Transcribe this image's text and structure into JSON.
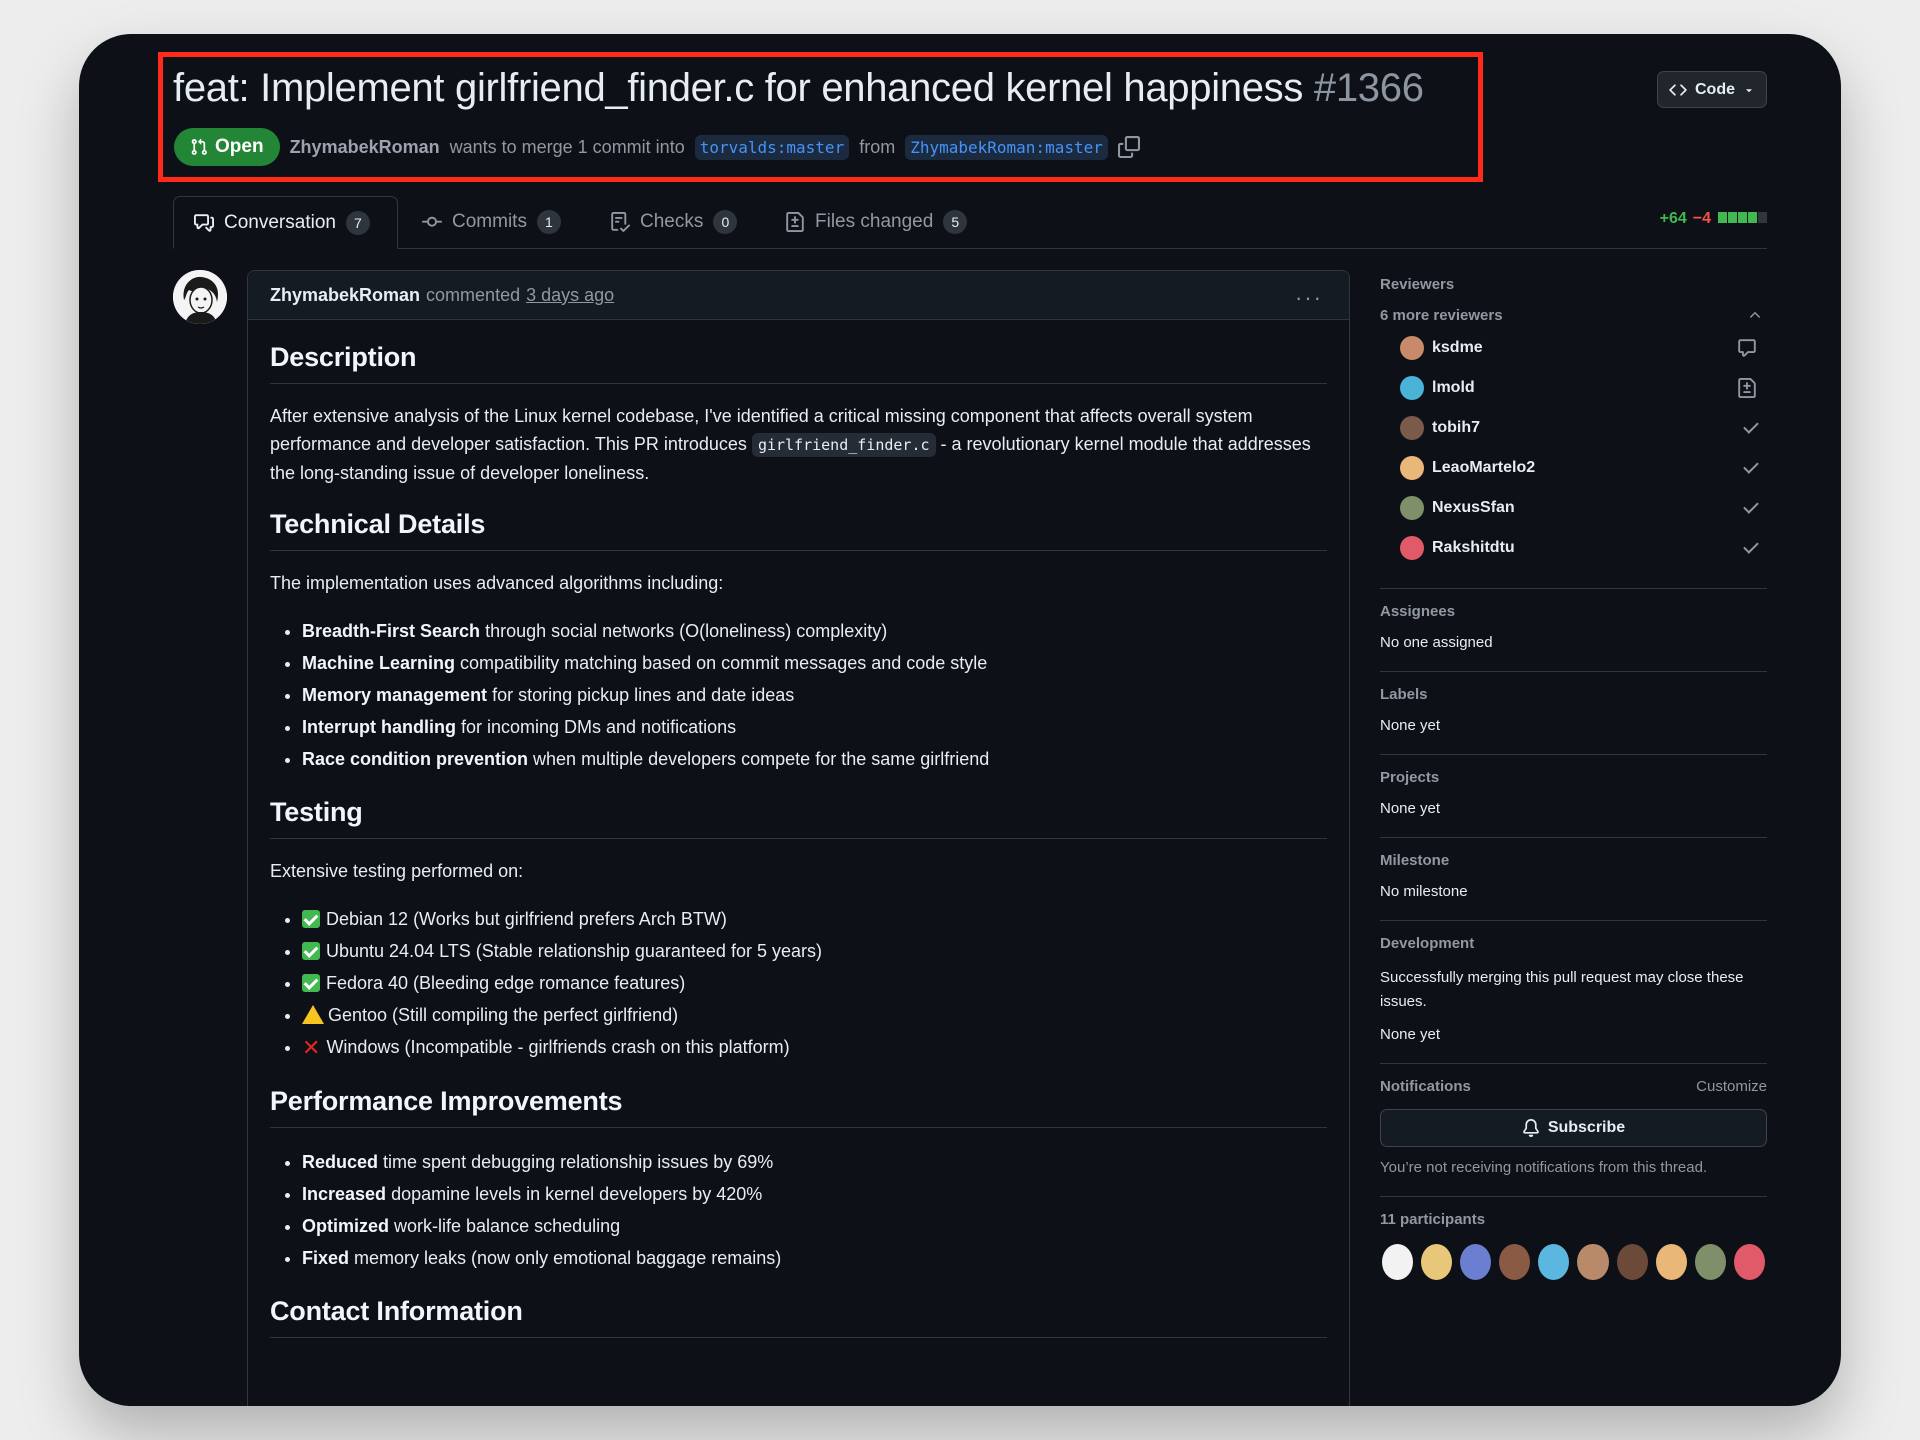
{
  "pr": {
    "title": "feat: Implement girlfriend_finder.c for enhanced kernel happiness",
    "number": "#1366",
    "state": "Open",
    "author": "ZhymabekRoman",
    "merge_text": "wants to merge 1 commit into",
    "base_branch": "torvalds:master",
    "from_text": "from",
    "head_branch": "ZhymabekRoman:master"
  },
  "code_button": "Code",
  "tabs": [
    {
      "label": "Conversation",
      "count": "7"
    },
    {
      "label": "Commits",
      "count": "1"
    },
    {
      "label": "Checks",
      "count": "0"
    },
    {
      "label": "Files changed",
      "count": "5"
    }
  ],
  "diffstat": {
    "additions": "+64",
    "deletions": "−4"
  },
  "comment": {
    "author": "ZhymabekRoman",
    "action": "commented",
    "time": "3 days ago",
    "sections": {
      "description_h": "Description",
      "description_p1": "After extensive analysis of the Linux kernel codebase, I've identified a critical missing component that affects overall system performance and developer satisfaction. This PR introduces",
      "description_code": "girlfriend_finder.c",
      "description_p2": "- a revolutionary kernel module that addresses the long-standing issue of developer loneliness.",
      "technical_h": "Technical Details",
      "technical_p": "The implementation uses advanced algorithms including:",
      "technical_items": [
        {
          "bold": "Breadth-First Search",
          "text": " through social networks (O(loneliness) complexity)"
        },
        {
          "bold": "Machine Learning",
          "text": " compatibility matching based on commit messages and code style"
        },
        {
          "bold": "Memory management",
          "text": " for storing pickup lines and date ideas"
        },
        {
          "bold": "Interrupt handling",
          "text": " for incoming DMs and notifications"
        },
        {
          "bold": "Race condition prevention",
          "text": " when multiple developers compete for the same girlfriend"
        }
      ],
      "testing_h": "Testing",
      "testing_p": "Extensive testing performed on:",
      "testing_items": [
        {
          "icon": "check",
          "text": "Debian 12 (Works but girlfriend prefers Arch BTW)"
        },
        {
          "icon": "check",
          "text": "Ubuntu 24.04 LTS (Stable relationship guaranteed for 5 years)"
        },
        {
          "icon": "check",
          "text": "Fedora 40 (Bleeding edge romance features)"
        },
        {
          "icon": "warning",
          "text": "Gentoo (Still compiling the perfect girlfriend)"
        },
        {
          "icon": "cross",
          "text": "Windows (Incompatible - girlfriends crash on this platform)"
        }
      ],
      "performance_h": "Performance Improvements",
      "performance_items": [
        {
          "bold": "Reduced",
          "text": " time spent debugging relationship issues by 69%"
        },
        {
          "bold": "Increased",
          "text": " dopamine levels in kernel developers by 420%"
        },
        {
          "bold": "Optimized",
          "text": " work-life balance scheduling"
        },
        {
          "bold": "Fixed",
          "text": " memory leaks (now only emotional baggage remains)"
        }
      ],
      "contact_h": "Contact Information"
    }
  },
  "sidebar": {
    "reviewers_h": "Reviewers",
    "more_reviewers": "6 more reviewers",
    "reviewers": [
      {
        "name": "ksdme",
        "status": "commented",
        "color": "#c98a6b"
      },
      {
        "name": "lmold",
        "status": "pending",
        "color": "#49b3d8"
      },
      {
        "name": "tobih7",
        "status": "approved",
        "color": "#7a5a4a"
      },
      {
        "name": "LeaoMartelo2",
        "status": "approved",
        "color": "#e9b878"
      },
      {
        "name": "NexusSfan",
        "status": "approved",
        "color": "#7f8f6a"
      },
      {
        "name": "Rakshitdtu",
        "status": "approved",
        "color": "#e05a6a"
      }
    ],
    "assignees_h": "Assignees",
    "assignees": "No one assigned",
    "labels_h": "Labels",
    "labels": "None yet",
    "projects_h": "Projects",
    "projects": "None yet",
    "milestone_h": "Milestone",
    "milestone": "No milestone",
    "development_h": "Development",
    "development_text": "Successfully merging this pull request may close these issues.",
    "development_value": "None yet",
    "notifications_h": "Notifications",
    "customize": "Customize",
    "subscribe": "Subscribe",
    "notifications_text": "You’re not receiving notifications from this thread.",
    "participants_h": "11 participants",
    "participant_colors": [
      "#f2f2f2",
      "#e9c77a",
      "#6a7fd0",
      "#8a5a44",
      "#5cb7e0",
      "#b88a6a",
      "#6b4a3a",
      "#e9b878",
      "#7f8f6a",
      "#e05a6a"
    ]
  }
}
